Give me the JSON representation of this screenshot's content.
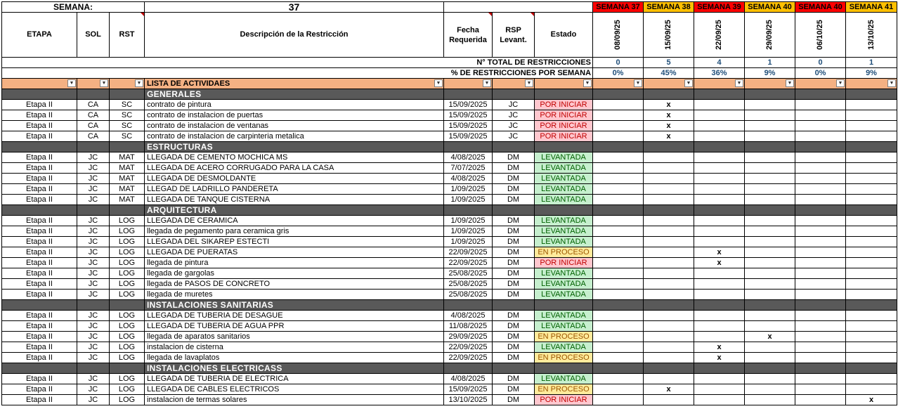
{
  "semana_label": "SEMANA:",
  "semana_value": "37",
  "headers": {
    "etapa": "ETAPA",
    "sol": "SOL",
    "rst": "RST",
    "descripcion": "Descripción de la Restricción",
    "fecha_line1": "Fecha",
    "fecha_line2": "Requerida",
    "rsp_line1": "RSP",
    "rsp_line2": "Levant.",
    "estado": "Estado"
  },
  "weeks": [
    {
      "label": "SEMANA 37",
      "date": "08/09/25",
      "total": "0",
      "pct": "0%",
      "color": "#ff0000"
    },
    {
      "label": "SEMANA 38",
      "date": "15/09/25",
      "total": "5",
      "pct": "45%",
      "color": "#ffc000"
    },
    {
      "label": "SEMANA 39",
      "date": "22/09/25",
      "total": "4",
      "pct": "36%",
      "color": "#ff0000"
    },
    {
      "label": "SEMANA 40",
      "date": "29/09/25",
      "total": "1",
      "pct": "9%",
      "color": "#ffc000"
    },
    {
      "label": "SEMANA 40",
      "date": "06/10/25",
      "total": "0",
      "pct": "0%",
      "color": "#ff0000"
    },
    {
      "label": "SEMANA 41",
      "date": "13/10/25",
      "total": "1",
      "pct": "9%",
      "color": "#ffc000"
    }
  ],
  "total_label": "N° TOTAL DE RESTRICCIONES",
  "pct_label": "% DE RESTRICCIONES POR SEMANA",
  "filter_label": "LISTA DE ACTIVIDAES",
  "sections": [
    {
      "title": "GENERALES",
      "rows": [
        {
          "etapa": "Etapa II",
          "sol": "CA",
          "rst": "SC",
          "desc": "contrato de pintura",
          "fecha": "15/09/2025",
          "rsp": "JC",
          "estado": "POR INICIAR",
          "wk": 1
        },
        {
          "etapa": "Etapa II",
          "sol": "CA",
          "rst": "SC",
          "desc": "contrato de instalacion de puertas",
          "fecha": "15/09/2025",
          "rsp": "JC",
          "estado": "POR INICIAR",
          "wk": 1
        },
        {
          "etapa": "Etapa II",
          "sol": "CA",
          "rst": "SC",
          "desc": "contrato de instalacion de ventanas",
          "fecha": "15/09/2025",
          "rsp": "JC",
          "estado": "POR INICIAR",
          "wk": 1
        },
        {
          "etapa": "Etapa II",
          "sol": "CA",
          "rst": "SC",
          "desc": "contrato de instalacion de carpinteria metalica",
          "fecha": "15/09/2025",
          "rsp": "JC",
          "estado": "POR INICIAR",
          "wk": 1
        }
      ]
    },
    {
      "title": "ESTRUCTURAS",
      "rows": [
        {
          "etapa": "Etapa II",
          "sol": "JC",
          "rst": "MAT",
          "desc": "LLEGADA DE CEMENTO MOCHICA MS",
          "fecha": "4/08/2025",
          "rsp": "DM",
          "estado": "LEVANTADA",
          "wk": -1
        },
        {
          "etapa": "Etapa II",
          "sol": "JC",
          "rst": "MAT",
          "desc": "LLEGADA DE ACERO CORRUGADO PARA LA CASA",
          "fecha": "7/07/2025",
          "rsp": "DM",
          "estado": "LEVANTADA",
          "wk": -1
        },
        {
          "etapa": "Etapa II",
          "sol": "JC",
          "rst": "MAT",
          "desc": "LLEGADA DE DESMOLDANTE",
          "fecha": "4/08/2025",
          "rsp": "DM",
          "estado": "LEVANTADA",
          "wk": -1
        },
        {
          "etapa": "Etapa II",
          "sol": "JC",
          "rst": "MAT",
          "desc": "LLEGAD DE LADRILLO PANDERETA",
          "fecha": "1/09/2025",
          "rsp": "DM",
          "estado": "LEVANTADA",
          "wk": -1
        },
        {
          "etapa": "Etapa II",
          "sol": "JC",
          "rst": "MAT",
          "desc": "LLEGADA DE TANQUE CISTERNA",
          "fecha": "1/09/2025",
          "rsp": "DM",
          "estado": "LEVANTADA",
          "wk": -1
        }
      ]
    },
    {
      "title": "ARQUITECTURA",
      "rows": [
        {
          "etapa": "Etapa II",
          "sol": "JC",
          "rst": "LOG",
          "desc": "LLEGADA DE CERAMICA",
          "fecha": "1/09/2025",
          "rsp": "DM",
          "estado": "LEVANTADA",
          "wk": -1
        },
        {
          "etapa": "Etapa II",
          "sol": "JC",
          "rst": "LOG",
          "desc": "llegada de pegamento para ceramica gris",
          "fecha": "1/09/2025",
          "rsp": "DM",
          "estado": "LEVANTADA",
          "wk": -1
        },
        {
          "etapa": "Etapa II",
          "sol": "JC",
          "rst": "LOG",
          "desc": "LLEGADA DEL SIKAREP ESTECTI",
          "fecha": "1/09/2025",
          "rsp": "DM",
          "estado": "LEVANTADA",
          "wk": -1
        },
        {
          "etapa": "Etapa II",
          "sol": "JC",
          "rst": "LOG",
          "desc": "LLEGADA DE PUERATAS",
          "fecha": "22/09/2025",
          "rsp": "DM",
          "estado": "EN PROCESO",
          "wk": 2
        },
        {
          "etapa": "Etapa II",
          "sol": "JC",
          "rst": "LOG",
          "desc": "llegada de pintura",
          "fecha": "22/09/2025",
          "rsp": "DM",
          "estado": "POR INICIAR",
          "wk": 2
        },
        {
          "etapa": "Etapa II",
          "sol": "JC",
          "rst": "LOG",
          "desc": "llegada de gargolas",
          "fecha": "25/08/2025",
          "rsp": "DM",
          "estado": "LEVANTADA",
          "wk": -1
        },
        {
          "etapa": "Etapa II",
          "sol": "JC",
          "rst": "LOG",
          "desc": "llegada de PASOS DE CONCRETO",
          "fecha": "25/08/2025",
          "rsp": "DM",
          "estado": "LEVANTADA",
          "wk": -1
        },
        {
          "etapa": "Etapa II",
          "sol": "JC",
          "rst": "LOG",
          "desc": "llegada de muretes",
          "fecha": "25/08/2025",
          "rsp": "DM",
          "estado": "LEVANTADA",
          "wk": -1
        }
      ]
    },
    {
      "title": "INSTALACIONES SANITARIAS",
      "rows": [
        {
          "etapa": "Etapa II",
          "sol": "JC",
          "rst": "LOG",
          "desc": "LLEGADA DE TUBERIA DE DESAGUE",
          "fecha": "4/08/2025",
          "rsp": "DM",
          "estado": "LEVANTADA",
          "wk": -1
        },
        {
          "etapa": "Etapa II",
          "sol": "JC",
          "rst": "LOG",
          "desc": "LLEGADA DE TUBERIA DE AGUA  PPR",
          "fecha": "11/08/2025",
          "rsp": "DM",
          "estado": "LEVANTADA",
          "wk": -1
        },
        {
          "etapa": "Etapa II",
          "sol": "JC",
          "rst": "LOG",
          "desc": "llegada de aparatos sanitarios",
          "fecha": "29/09/2025",
          "rsp": "DM",
          "estado": "EN PROCESO",
          "wk": 3
        },
        {
          "etapa": "Etapa II",
          "sol": "JC",
          "rst": "LOG",
          "desc": "instalacion de cisterna",
          "fecha": "22/09/2025",
          "rsp": "DM",
          "estado": "LEVANTADA",
          "wk": 2
        },
        {
          "etapa": "Etapa II",
          "sol": "JC",
          "rst": "LOG",
          "desc": "llegada de lavaplatos",
          "fecha": "22/09/2025",
          "rsp": "DM",
          "estado": "EN PROCESO",
          "wk": 2
        }
      ]
    },
    {
      "title": "INSTALACIONES ELECTRICASS",
      "rows": [
        {
          "etapa": "Etapa II",
          "sol": "JC",
          "rst": "LOG",
          "desc": "LLEGADA DE TUBERIA DE ELECTRICA",
          "fecha": "4/08/2025",
          "rsp": "DM",
          "estado": "LEVANTADA",
          "wk": -1
        },
        {
          "etapa": "Etapa II",
          "sol": "JC",
          "rst": "LOG",
          "desc": "LLEGADA DE CABLES ELECTRICOS",
          "fecha": "15/09/2025",
          "rsp": "DM",
          "estado": "EN PROCESO",
          "wk": 1
        },
        {
          "etapa": "Etapa II",
          "sol": "JC",
          "rst": "LOG",
          "desc": "instalacion de termas solares",
          "fecha": "13/10/2025",
          "rsp": "DM",
          "estado": "POR INICIAR",
          "wk": 5
        }
      ]
    }
  ],
  "mark": "x",
  "filter_icon": "dropdown-arrow-icon",
  "status_colors": {
    "POR INICIAR": "#ffc7ce",
    "LEVANTADA": "#c6efce",
    "EN PROCESO": "#ffeb9c"
  }
}
